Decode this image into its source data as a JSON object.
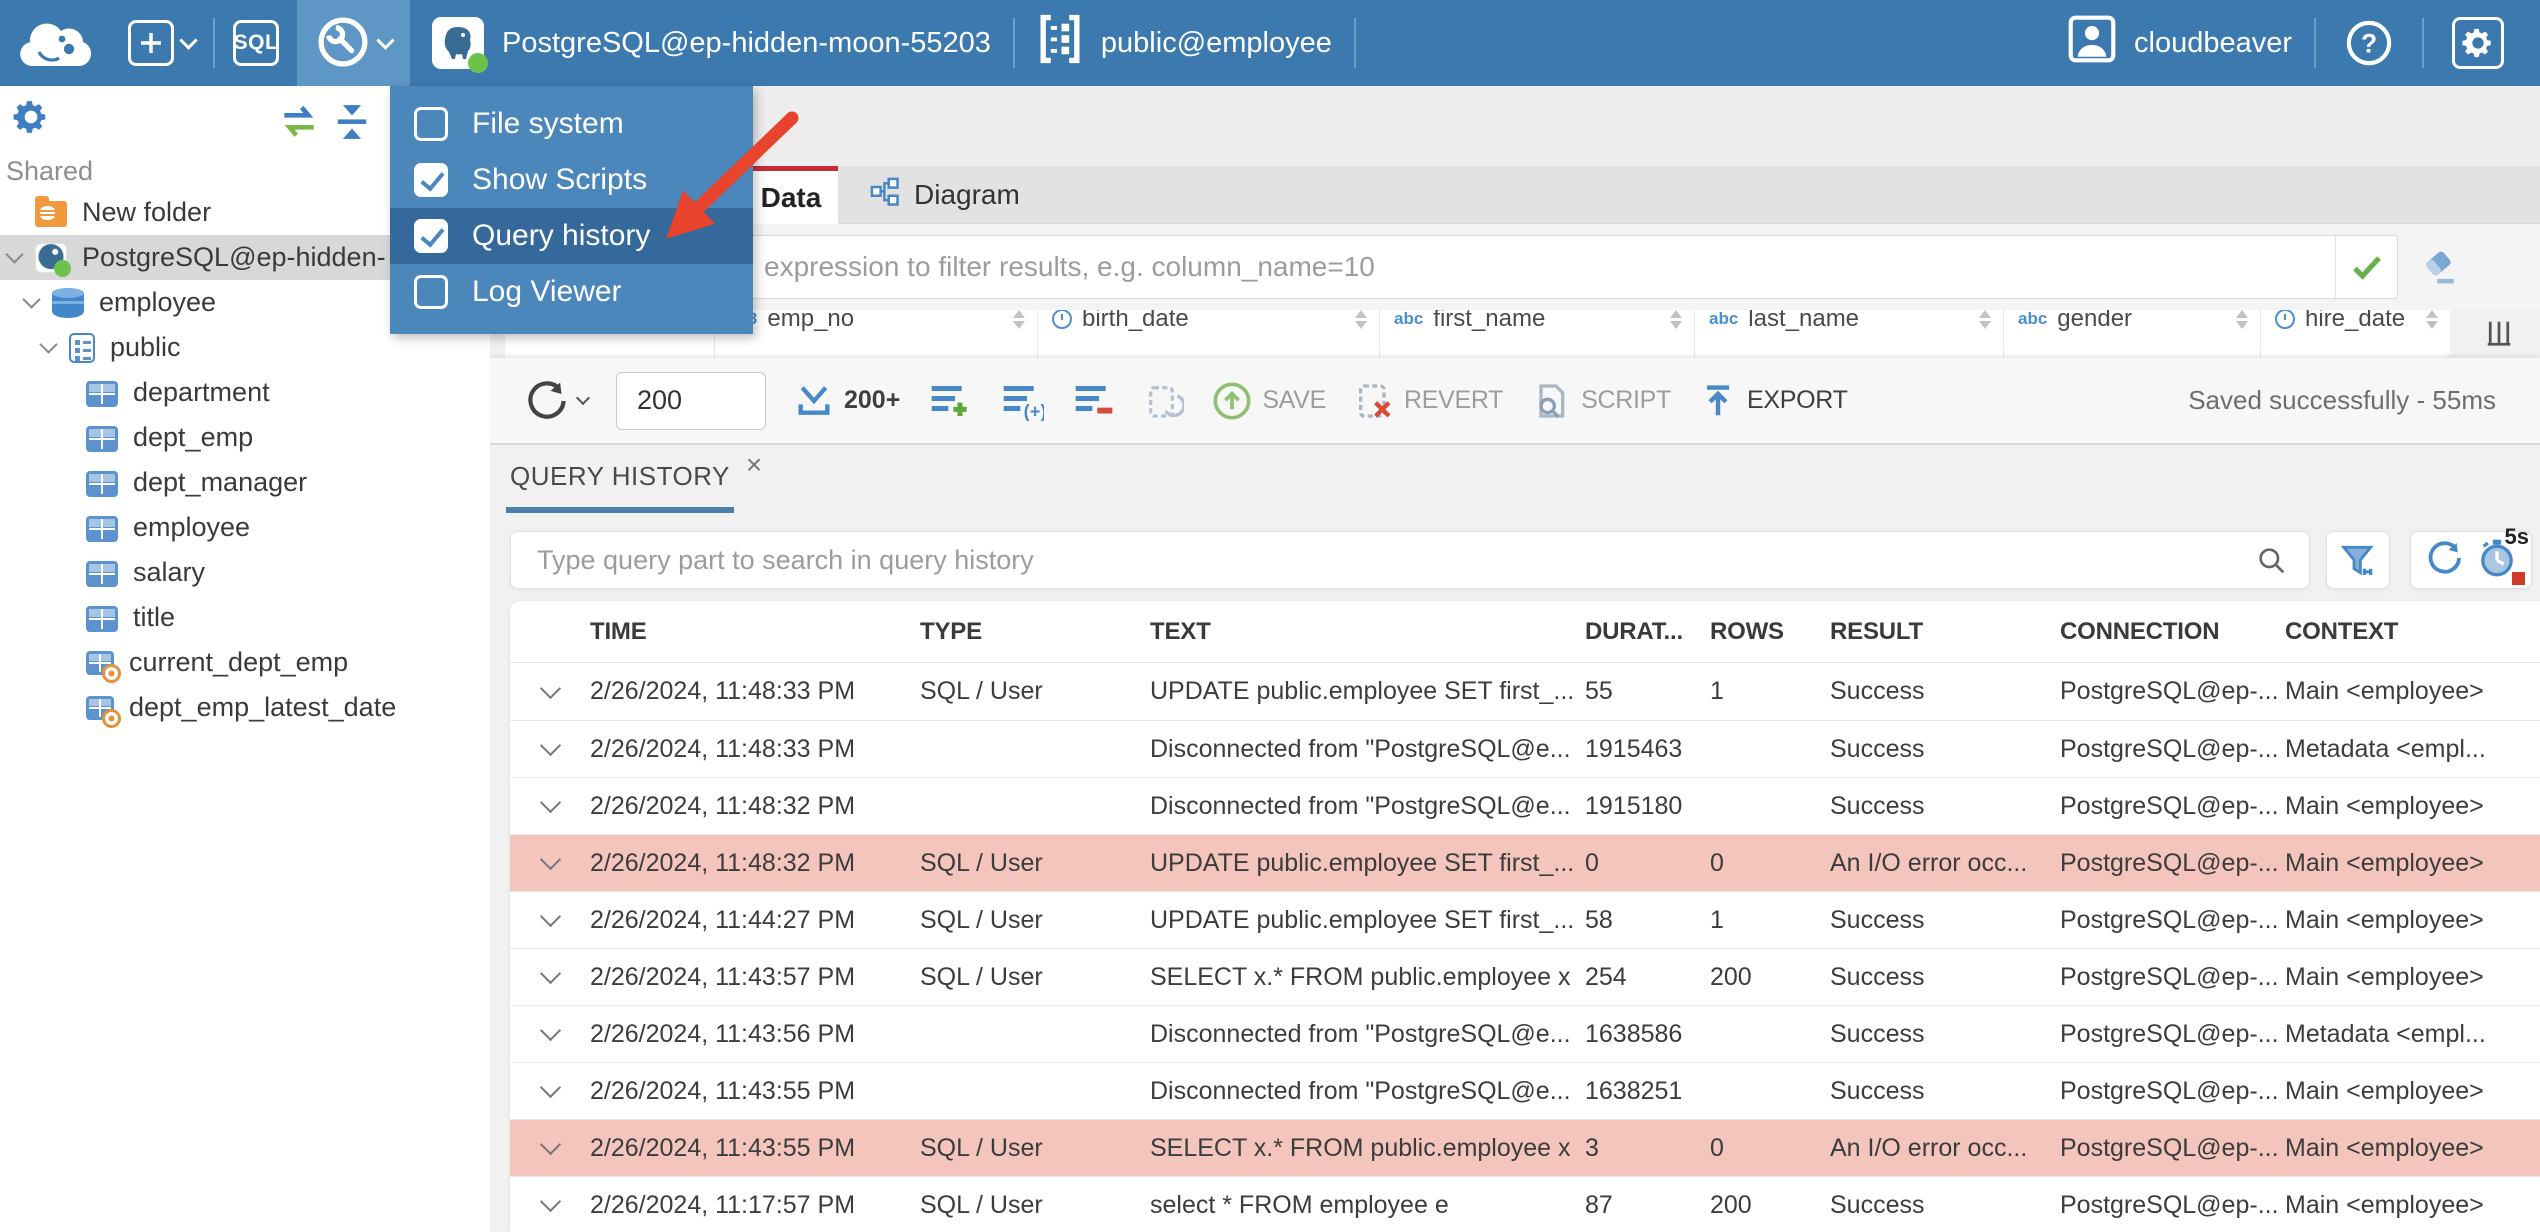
{
  "colors": {
    "topbar_bg": "#3b79ae",
    "topbar_active_bg": "#5e96c6",
    "menu_bg": "#4c87bb",
    "menu_highlight_bg": "#35699b",
    "selection_bg": "#d8d8d8",
    "error_row_bg": "#f3c5bc",
    "accent_blue": "#4788c7",
    "tab_red": "#c92b3a",
    "underline_blue": "#4a7fad",
    "status_green": "#6cc24a",
    "arrow_red": "#e8432c"
  },
  "topbar": {
    "sql_label": "SQL",
    "connection_name": "PostgreSQL@ep-hidden-moon-55203",
    "schema_name": "public@employee",
    "user_name": "cloudbeaver"
  },
  "tools_menu": {
    "items": [
      {
        "label": "File system",
        "checked": false,
        "highlighted": false
      },
      {
        "label": "Show Scripts",
        "checked": true,
        "highlighted": false
      },
      {
        "label": "Query history",
        "checked": true,
        "highlighted": true
      },
      {
        "label": "Log Viewer",
        "checked": false,
        "highlighted": false
      }
    ]
  },
  "sidebar": {
    "section_label": "Shared",
    "tree": [
      {
        "label": "New folder",
        "icon": "folder-database-icon",
        "level": 0,
        "chevron": false,
        "selected": false
      },
      {
        "label": "PostgreSQL@ep-hidden-",
        "icon": "postgres-connection-icon",
        "level": 0,
        "chevron": true,
        "selected": true
      },
      {
        "label": "employee",
        "icon": "database-icon",
        "level": 1,
        "chevron": true,
        "selected": false
      },
      {
        "label": "public",
        "icon": "schema-icon",
        "level": 2,
        "chevron": true,
        "selected": false
      },
      {
        "label": "department",
        "icon": "table-icon",
        "level": 3,
        "chevron": false,
        "selected": false
      },
      {
        "label": "dept_emp",
        "icon": "table-icon",
        "level": 3,
        "chevron": false,
        "selected": false
      },
      {
        "label": "dept_manager",
        "icon": "table-icon",
        "level": 3,
        "chevron": false,
        "selected": false
      },
      {
        "label": "employee",
        "icon": "table-icon",
        "level": 3,
        "chevron": false,
        "selected": false
      },
      {
        "label": "salary",
        "icon": "table-icon",
        "level": 3,
        "chevron": false,
        "selected": false
      },
      {
        "label": "title",
        "icon": "table-icon",
        "level": 3,
        "chevron": false,
        "selected": false
      },
      {
        "label": "current_dept_emp",
        "icon": "view-icon",
        "level": 3,
        "chevron": false,
        "selected": false
      },
      {
        "label": "dept_emp_latest_date",
        "icon": "view-icon",
        "level": 3,
        "chevron": false,
        "selected": false
      }
    ]
  },
  "tabs": {
    "data_label": "Data",
    "diagram_label": "Diagram"
  },
  "filter": {
    "placeholder": "expression to filter results, e.g. column_name=10"
  },
  "grid_preview": {
    "columns": [
      {
        "icon": "row-index",
        "label": "#"
      },
      {
        "icon": "numeric",
        "label": "emp_no"
      },
      {
        "icon": "datetime",
        "label": "birth_date"
      },
      {
        "icon": "text",
        "label": "first_name"
      },
      {
        "icon": "text",
        "label": "last_name"
      },
      {
        "icon": "text",
        "label": "gender"
      },
      {
        "icon": "datetime",
        "label": "hire_date"
      }
    ]
  },
  "toolbar": {
    "row_limit": "200",
    "fetch_size_label": "200+",
    "save_label": "SAVE",
    "revert_label": "REVERT",
    "script_label": "SCRIPT",
    "export_label": "EXPORT",
    "status": "Saved successfully - 55ms"
  },
  "query_history": {
    "tab_label": "QUERY HISTORY",
    "search_placeholder": "Type query part to search in query history",
    "auto_refresh_label": "5s",
    "columns": [
      "TIME",
      "TYPE",
      "TEXT",
      "DURAT...",
      "ROWS",
      "RESULT",
      "CONNECTION",
      "CONTEXT"
    ],
    "rows": [
      {
        "time": "2/26/2024, 11:48:33 PM",
        "type": "SQL / User",
        "text": "UPDATE public.employee SET first_...",
        "duration": "55",
        "rows": "1",
        "result": "Success",
        "connection": "PostgreSQL@ep-...",
        "context": "Main <employee>",
        "error": false
      },
      {
        "time": "2/26/2024, 11:48:33 PM",
        "type": "",
        "text": "Disconnected from \"PostgreSQL@e...",
        "duration": "1915463",
        "rows": "",
        "result": "Success",
        "connection": "PostgreSQL@ep-...",
        "context": "Metadata <empl...",
        "error": false
      },
      {
        "time": "2/26/2024, 11:48:32 PM",
        "type": "",
        "text": "Disconnected from \"PostgreSQL@e...",
        "duration": "1915180",
        "rows": "",
        "result": "Success",
        "connection": "PostgreSQL@ep-...",
        "context": "Main <employee>",
        "error": false
      },
      {
        "time": "2/26/2024, 11:48:32 PM",
        "type": "SQL / User",
        "text": "UPDATE public.employee SET first_...",
        "duration": "0",
        "rows": "0",
        "result": "An I/O error occ...",
        "connection": "PostgreSQL@ep-...",
        "context": "Main <employee>",
        "error": true
      },
      {
        "time": "2/26/2024, 11:44:27 PM",
        "type": "SQL / User",
        "text": "UPDATE public.employee SET first_...",
        "duration": "58",
        "rows": "1",
        "result": "Success",
        "connection": "PostgreSQL@ep-...",
        "context": "Main <employee>",
        "error": false
      },
      {
        "time": "2/26/2024, 11:43:57 PM",
        "type": "SQL / User",
        "text": "SELECT x.* FROM public.employee x",
        "duration": "254",
        "rows": "200",
        "result": "Success",
        "connection": "PostgreSQL@ep-...",
        "context": "Main <employee>",
        "error": false
      },
      {
        "time": "2/26/2024, 11:43:56 PM",
        "type": "",
        "text": "Disconnected from \"PostgreSQL@e...",
        "duration": "1638586",
        "rows": "",
        "result": "Success",
        "connection": "PostgreSQL@ep-...",
        "context": "Metadata <empl...",
        "error": false
      },
      {
        "time": "2/26/2024, 11:43:55 PM",
        "type": "",
        "text": "Disconnected from \"PostgreSQL@e...",
        "duration": "1638251",
        "rows": "",
        "result": "Success",
        "connection": "PostgreSQL@ep-...",
        "context": "Main <employee>",
        "error": false
      },
      {
        "time": "2/26/2024, 11:43:55 PM",
        "type": "SQL / User",
        "text": "SELECT x.* FROM public.employee x",
        "duration": "3",
        "rows": "0",
        "result": "An I/O error occ...",
        "connection": "PostgreSQL@ep-...",
        "context": "Main <employee>",
        "error": true
      },
      {
        "time": "2/26/2024, 11:17:57 PM",
        "type": "SQL / User",
        "text": "select * FROM employee e",
        "duration": "87",
        "rows": "200",
        "result": "Success",
        "connection": "PostgreSQL@ep-...",
        "context": "Main <employee>",
        "error": false
      }
    ]
  }
}
